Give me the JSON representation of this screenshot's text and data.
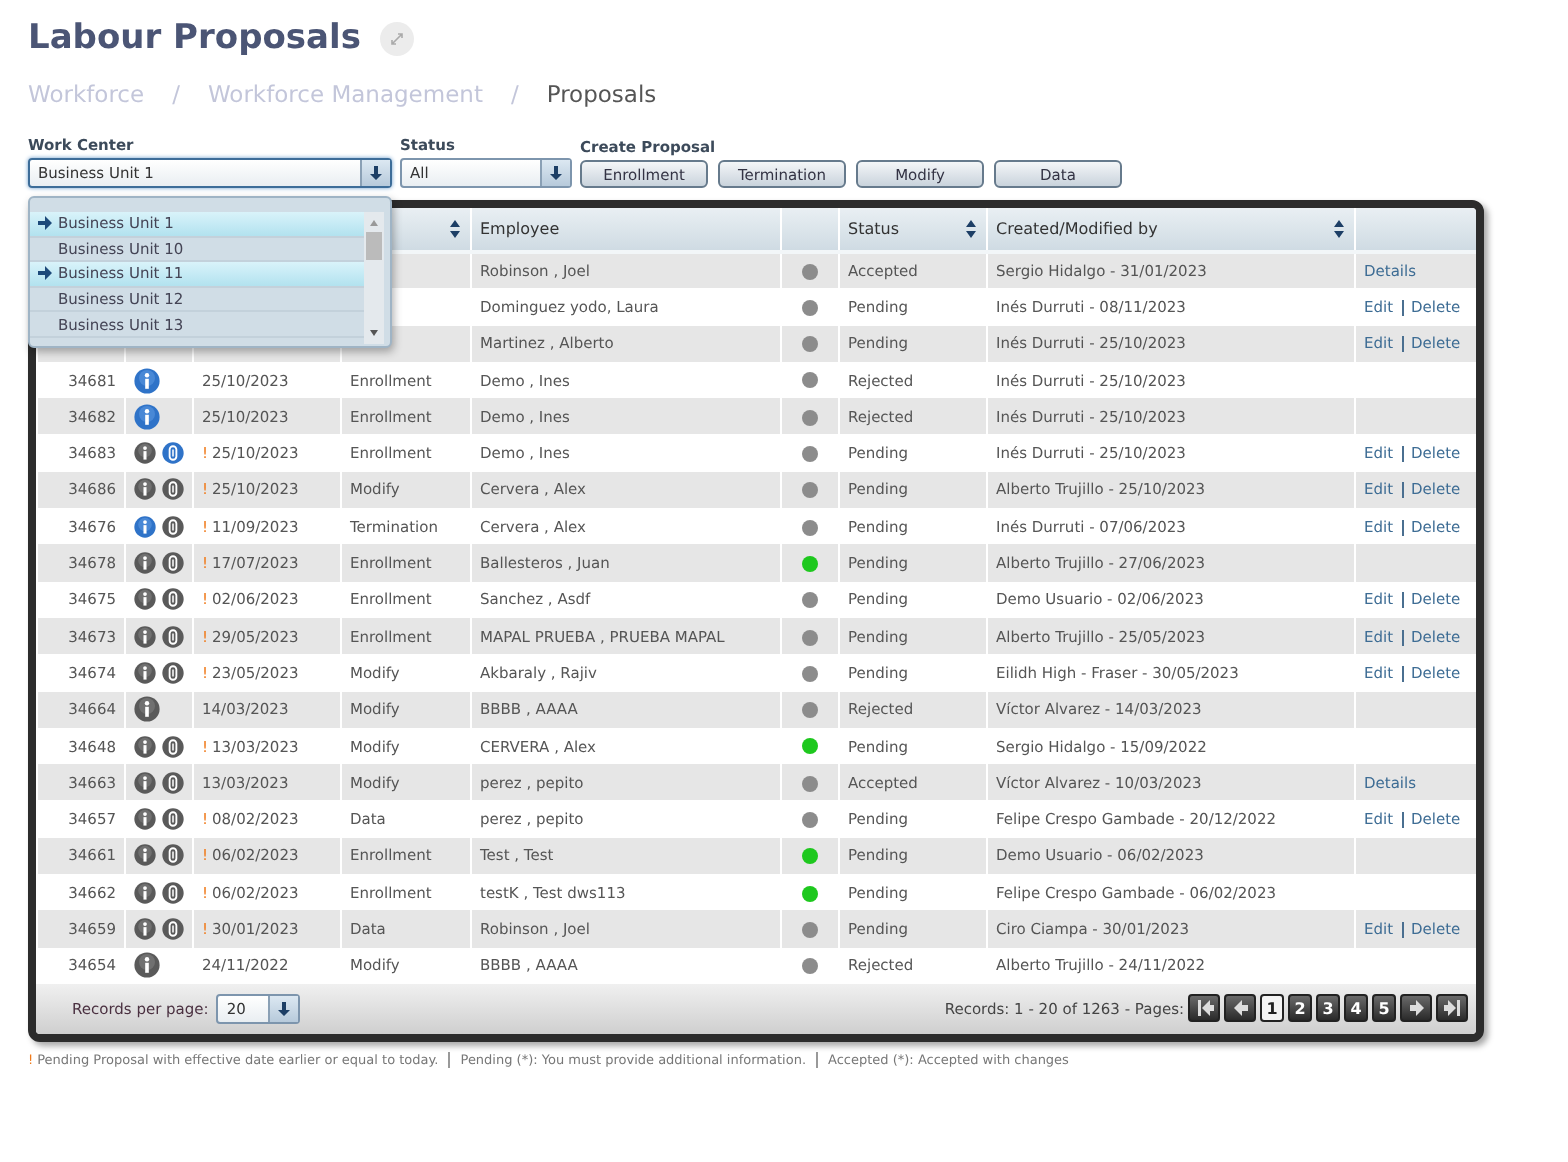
{
  "title": "Labour Proposals",
  "breadcrumb": {
    "separator": "/",
    "items": [
      {
        "label": "Workforce",
        "current": false
      },
      {
        "label": "Workforce Management",
        "current": false
      },
      {
        "label": "Proposals",
        "current": true
      }
    ]
  },
  "filters": {
    "work_center": {
      "label": "Work Center",
      "value": "Business Unit 1",
      "expanded": true,
      "options": [
        {
          "label": "Business Unit 1",
          "selected": true
        },
        {
          "label": "Business Unit 10",
          "selected": false
        },
        {
          "label": "Business Unit 11",
          "selected": true
        },
        {
          "label": "Business Unit 12",
          "selected": false
        },
        {
          "label": "Business Unit 13",
          "selected": false
        }
      ]
    },
    "status": {
      "label": "Status",
      "value": "All"
    },
    "create_proposal": {
      "label": "Create Proposal",
      "buttons": [
        "Enrollment",
        "Termination",
        "Modify",
        "Data"
      ]
    }
  },
  "table": {
    "columns": [
      {},
      {},
      {},
      {
        "sortable": true
      },
      {
        "label": "Employee",
        "sortable": false
      },
      {
        "sortable": false
      },
      {
        "label": "Status",
        "sortable": true
      },
      {
        "label": "Created/Modified by",
        "sortable": true
      },
      {
        "sortable": false
      }
    ],
    "rows": [
      {
        "employee": "Robinson , Joel",
        "color": "#8c8c8c",
        "status": "Accepted",
        "created": "Sergio Hidalgo - 31/01/2023",
        "actions": [
          "Details"
        ]
      },
      {
        "employee": "Dominguez yodo, Laura",
        "color": "#8c8c8c",
        "status": "Pending",
        "created": "Inés Durruti - 08/11/2023",
        "actions": [
          "Edit",
          "Delete"
        ]
      },
      {
        "employee": "Martinez , Alberto",
        "color": "#8c8c8c",
        "status": "Pending",
        "created": "Inés Durruti - 25/10/2023",
        "actions": [
          "Edit",
          "Delete"
        ]
      },
      {
        "id": "34681",
        "icons": [
          {
            "kind": "info",
            "active": true
          }
        ],
        "overdue": false,
        "date": "25/10/2023",
        "type": "Enrollment",
        "employee": "Demo , Ines",
        "color": "#8c8c8c",
        "status": "Rejected",
        "created": "Inés Durruti - 25/10/2023"
      },
      {
        "id": "34682",
        "icons": [
          {
            "kind": "info",
            "active": true
          }
        ],
        "overdue": false,
        "date": "25/10/2023",
        "type": "Enrollment",
        "employee": "Demo , Ines",
        "color": "#8c8c8c",
        "status": "Rejected",
        "created": "Inés Durruti - 25/10/2023"
      },
      {
        "id": "34683",
        "icons": [
          {
            "kind": "info",
            "active": false
          },
          {
            "kind": "clip",
            "active": true
          }
        ],
        "overdue": true,
        "date": "25/10/2023",
        "type": "Enrollment",
        "employee": "Demo , Ines",
        "color": "#8c8c8c",
        "status": "Pending",
        "created": "Inés Durruti - 25/10/2023",
        "actions": [
          "Edit",
          "Delete"
        ]
      },
      {
        "id": "34686",
        "icons": [
          {
            "kind": "info",
            "active": false
          },
          {
            "kind": "clip",
            "active": false
          }
        ],
        "overdue": true,
        "date": "25/10/2023",
        "type": "Modify",
        "employee": "Cervera , Alex",
        "color": "#8c8c8c",
        "status": "Pending",
        "created": "Alberto Trujillo - 25/10/2023",
        "actions": [
          "Edit",
          "Delete"
        ]
      },
      {
        "id": "34676",
        "icons": [
          {
            "kind": "info",
            "active": true
          },
          {
            "kind": "clip",
            "active": false
          }
        ],
        "overdue": true,
        "date": "11/09/2023",
        "type": "Termination",
        "employee": "Cervera , Alex",
        "color": "#8c8c8c",
        "status": "Pending",
        "created": "Inés Durruti - 07/06/2023",
        "actions": [
          "Edit",
          "Delete"
        ]
      },
      {
        "id": "34678",
        "icons": [
          {
            "kind": "info",
            "active": false
          },
          {
            "kind": "clip",
            "active": false
          }
        ],
        "overdue": true,
        "date": "17/07/2023",
        "type": "Enrollment",
        "employee": "Ballesteros , Juan",
        "color": "#1ec81e",
        "status": "Pending",
        "created": "Alberto Trujillo - 27/06/2023"
      },
      {
        "id": "34675",
        "icons": [
          {
            "kind": "info",
            "active": false
          },
          {
            "kind": "clip",
            "active": false
          }
        ],
        "overdue": true,
        "date": "02/06/2023",
        "type": "Enrollment",
        "employee": "Sanchez , Asdf",
        "color": "#8c8c8c",
        "status": "Pending",
        "created": "Demo Usuario - 02/06/2023",
        "actions": [
          "Edit",
          "Delete"
        ]
      },
      {
        "id": "34673",
        "icons": [
          {
            "kind": "info",
            "active": false
          },
          {
            "kind": "clip",
            "active": false
          }
        ],
        "overdue": true,
        "date": "29/05/2023",
        "type": "Enrollment",
        "employee": "MAPAL PRUEBA , PRUEBA MAPAL",
        "color": "#8c8c8c",
        "status": "Pending",
        "created": "Alberto Trujillo - 25/05/2023",
        "actions": [
          "Edit",
          "Delete"
        ]
      },
      {
        "id": "34674",
        "icons": [
          {
            "kind": "info",
            "active": false
          },
          {
            "kind": "clip",
            "active": false
          }
        ],
        "overdue": true,
        "date": "23/05/2023",
        "type": "Modify",
        "employee": "Akbaraly , Rajiv",
        "color": "#8c8c8c",
        "status": "Pending",
        "created": "Eilidh High - Fraser - 30/05/2023",
        "actions": [
          "Edit",
          "Delete"
        ]
      },
      {
        "id": "34664",
        "icons": [
          {
            "kind": "info",
            "active": false
          }
        ],
        "overdue": false,
        "date": "14/03/2023",
        "type": "Modify",
        "employee": "BBBB , AAAA",
        "color": "#8c8c8c",
        "status": "Rejected",
        "created": "Víctor Alvarez - 14/03/2023"
      },
      {
        "id": "34648",
        "icons": [
          {
            "kind": "info",
            "active": false
          },
          {
            "kind": "clip",
            "active": false
          }
        ],
        "overdue": true,
        "date": "13/03/2023",
        "type": "Modify",
        "employee": "CERVERA , Alex",
        "color": "#1ec81e",
        "status": "Pending",
        "created": "Sergio Hidalgo - 15/09/2022"
      },
      {
        "id": "34663",
        "icons": [
          {
            "kind": "info",
            "active": false
          },
          {
            "kind": "clip",
            "active": false
          }
        ],
        "overdue": false,
        "date": "13/03/2023",
        "type": "Modify",
        "employee": "perez , pepito",
        "color": "#8c8c8c",
        "status": "Accepted",
        "created": "Víctor Alvarez - 10/03/2023",
        "actions": [
          "Details"
        ]
      },
      {
        "id": "34657",
        "icons": [
          {
            "kind": "info",
            "active": false
          },
          {
            "kind": "clip",
            "active": false
          }
        ],
        "overdue": true,
        "date": "08/02/2023",
        "type": "Data",
        "employee": "perez , pepito",
        "color": "#8c8c8c",
        "status": "Pending",
        "created": "Felipe Crespo Gambade - 20/12/2022",
        "actions": [
          "Edit",
          "Delete"
        ]
      },
      {
        "id": "34661",
        "icons": [
          {
            "kind": "info",
            "active": false
          },
          {
            "kind": "clip",
            "active": false
          }
        ],
        "overdue": true,
        "date": "06/02/2023",
        "type": "Enrollment",
        "employee": "Test , Test",
        "color": "#1ec81e",
        "status": "Pending",
        "created": "Demo Usuario - 06/02/2023"
      },
      {
        "id": "34662",
        "icons": [
          {
            "kind": "info",
            "active": false
          },
          {
            "kind": "clip",
            "active": false
          }
        ],
        "overdue": true,
        "date": "06/02/2023",
        "type": "Enrollment",
        "employee": "testK , Test dws113",
        "color": "#1ec81e",
        "status": "Pending",
        "created": "Felipe Crespo Gambade - 06/02/2023"
      },
      {
        "id": "34659",
        "icons": [
          {
            "kind": "info",
            "active": false
          },
          {
            "kind": "clip",
            "active": false
          }
        ],
        "overdue": true,
        "date": "30/01/2023",
        "type": "Data",
        "employee": "Robinson , Joel",
        "color": "#8c8c8c",
        "status": "Pending",
        "created": "Ciro Ciampa - 30/01/2023",
        "actions": [
          "Edit",
          "Delete"
        ]
      },
      {
        "id": "34654",
        "icons": [
          {
            "kind": "info",
            "active": false
          }
        ],
        "overdue": false,
        "date": "24/11/2022",
        "type": "Modify",
        "employee": "BBBB , AAAA",
        "color": "#8c8c8c",
        "status": "Rejected",
        "created": "Alberto Trujillo - 24/11/2022"
      }
    ]
  },
  "footer": {
    "per_page_label": "Records per page:",
    "per_page": "20",
    "records": "Records: 1 - 20 of 1263 - Pages:",
    "pages": [
      {
        "label": "1",
        "selected": true
      },
      {
        "label": "2",
        "selected": false
      },
      {
        "label": "3",
        "selected": false
      },
      {
        "label": "4",
        "selected": false
      },
      {
        "label": "5",
        "selected": false
      }
    ]
  },
  "overdue_mark": "!",
  "legend": [
    {
      "text": "Pending Proposal with effective date earlier or equal to today.",
      "flagged": true
    },
    {
      "text": "Pending (*): You must provide additional information.",
      "flagged": false
    },
    {
      "text": "Accepted (*): Accepted with changes",
      "flagged": false
    }
  ]
}
